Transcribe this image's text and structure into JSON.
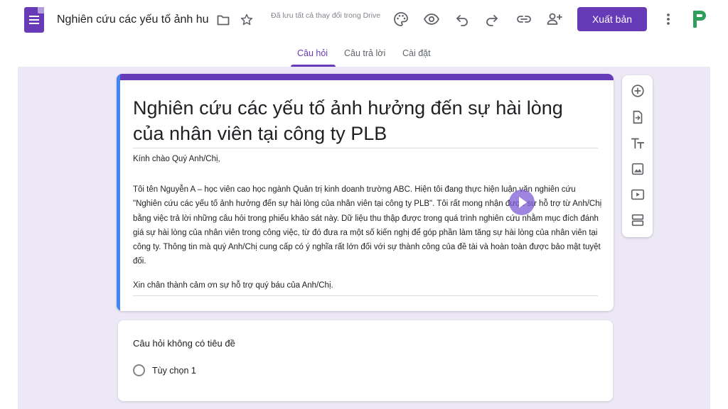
{
  "header": {
    "doc_title": "Nghiên cứu các yếu tố ảnh hu",
    "save_status": "Đã lưu tất cả thay đổi trong Drive",
    "publish_label": "Xuất bản",
    "icons": [
      "forms-app-icon",
      "folder-icon",
      "star-icon",
      "palette-icon",
      "eye-icon",
      "undo-icon",
      "redo-icon",
      "link-icon",
      "add-person-icon",
      "more-vert-icon",
      "brand-logo"
    ]
  },
  "tabs": [
    {
      "label": "Câu hỏi",
      "active": true
    },
    {
      "label": "Câu trả lời",
      "active": false
    },
    {
      "label": "Cài đặt",
      "active": false
    }
  ],
  "form": {
    "title": "Nghiên cứu các yếu tố ảnh hưởng đến sự hài lòng của nhân viên tại công ty PLB",
    "greeting": "Kính chào Quý Anh/Chị,",
    "description": "Tôi tên Nguyễn A – học viên cao học ngành Quản trị kinh doanh trường ABC. Hiện tôi đang thực hiện luận văn nghiên cứu \"Nghiên cứu các yếu tố ảnh hưởng đến sự hài lòng của nhân viên tại công ty PLB\". Tôi rất mong nhận được sự hỗ trợ từ Anh/Chị bằng việc trả lời những câu hỏi trong phiếu khảo sát này. Dữ liệu thu thập được trong quá trình nghiên cứu nhằm mục đích đánh giá sự hài lòng của nhân viên trong công việc, từ đó đưa ra một số kiến nghị để góp phần làm tăng sự hài lòng của nhân viên tại công ty. Thông tin mà quý Anh/Chị cung cấp có ý nghĩa rất lớn đối với sự thành công của đề tài và hoàn toàn được bảo mật tuyệt đối.",
    "closing": "Xin chân thành cảm ơn sự hỗ trợ quý báu của Anh/Chị."
  },
  "question": {
    "title": "Câu hỏi không có tiêu đề",
    "option": "Tùy chọn 1"
  },
  "side_toolbar": [
    "add-question-icon",
    "import-questions-icon",
    "add-title-icon",
    "add-image-icon",
    "add-video-icon",
    "add-section-icon"
  ],
  "colors": {
    "accent": "#673ab7",
    "canvas_bg": "#ece8f6",
    "left_strip": "#4285f4"
  }
}
